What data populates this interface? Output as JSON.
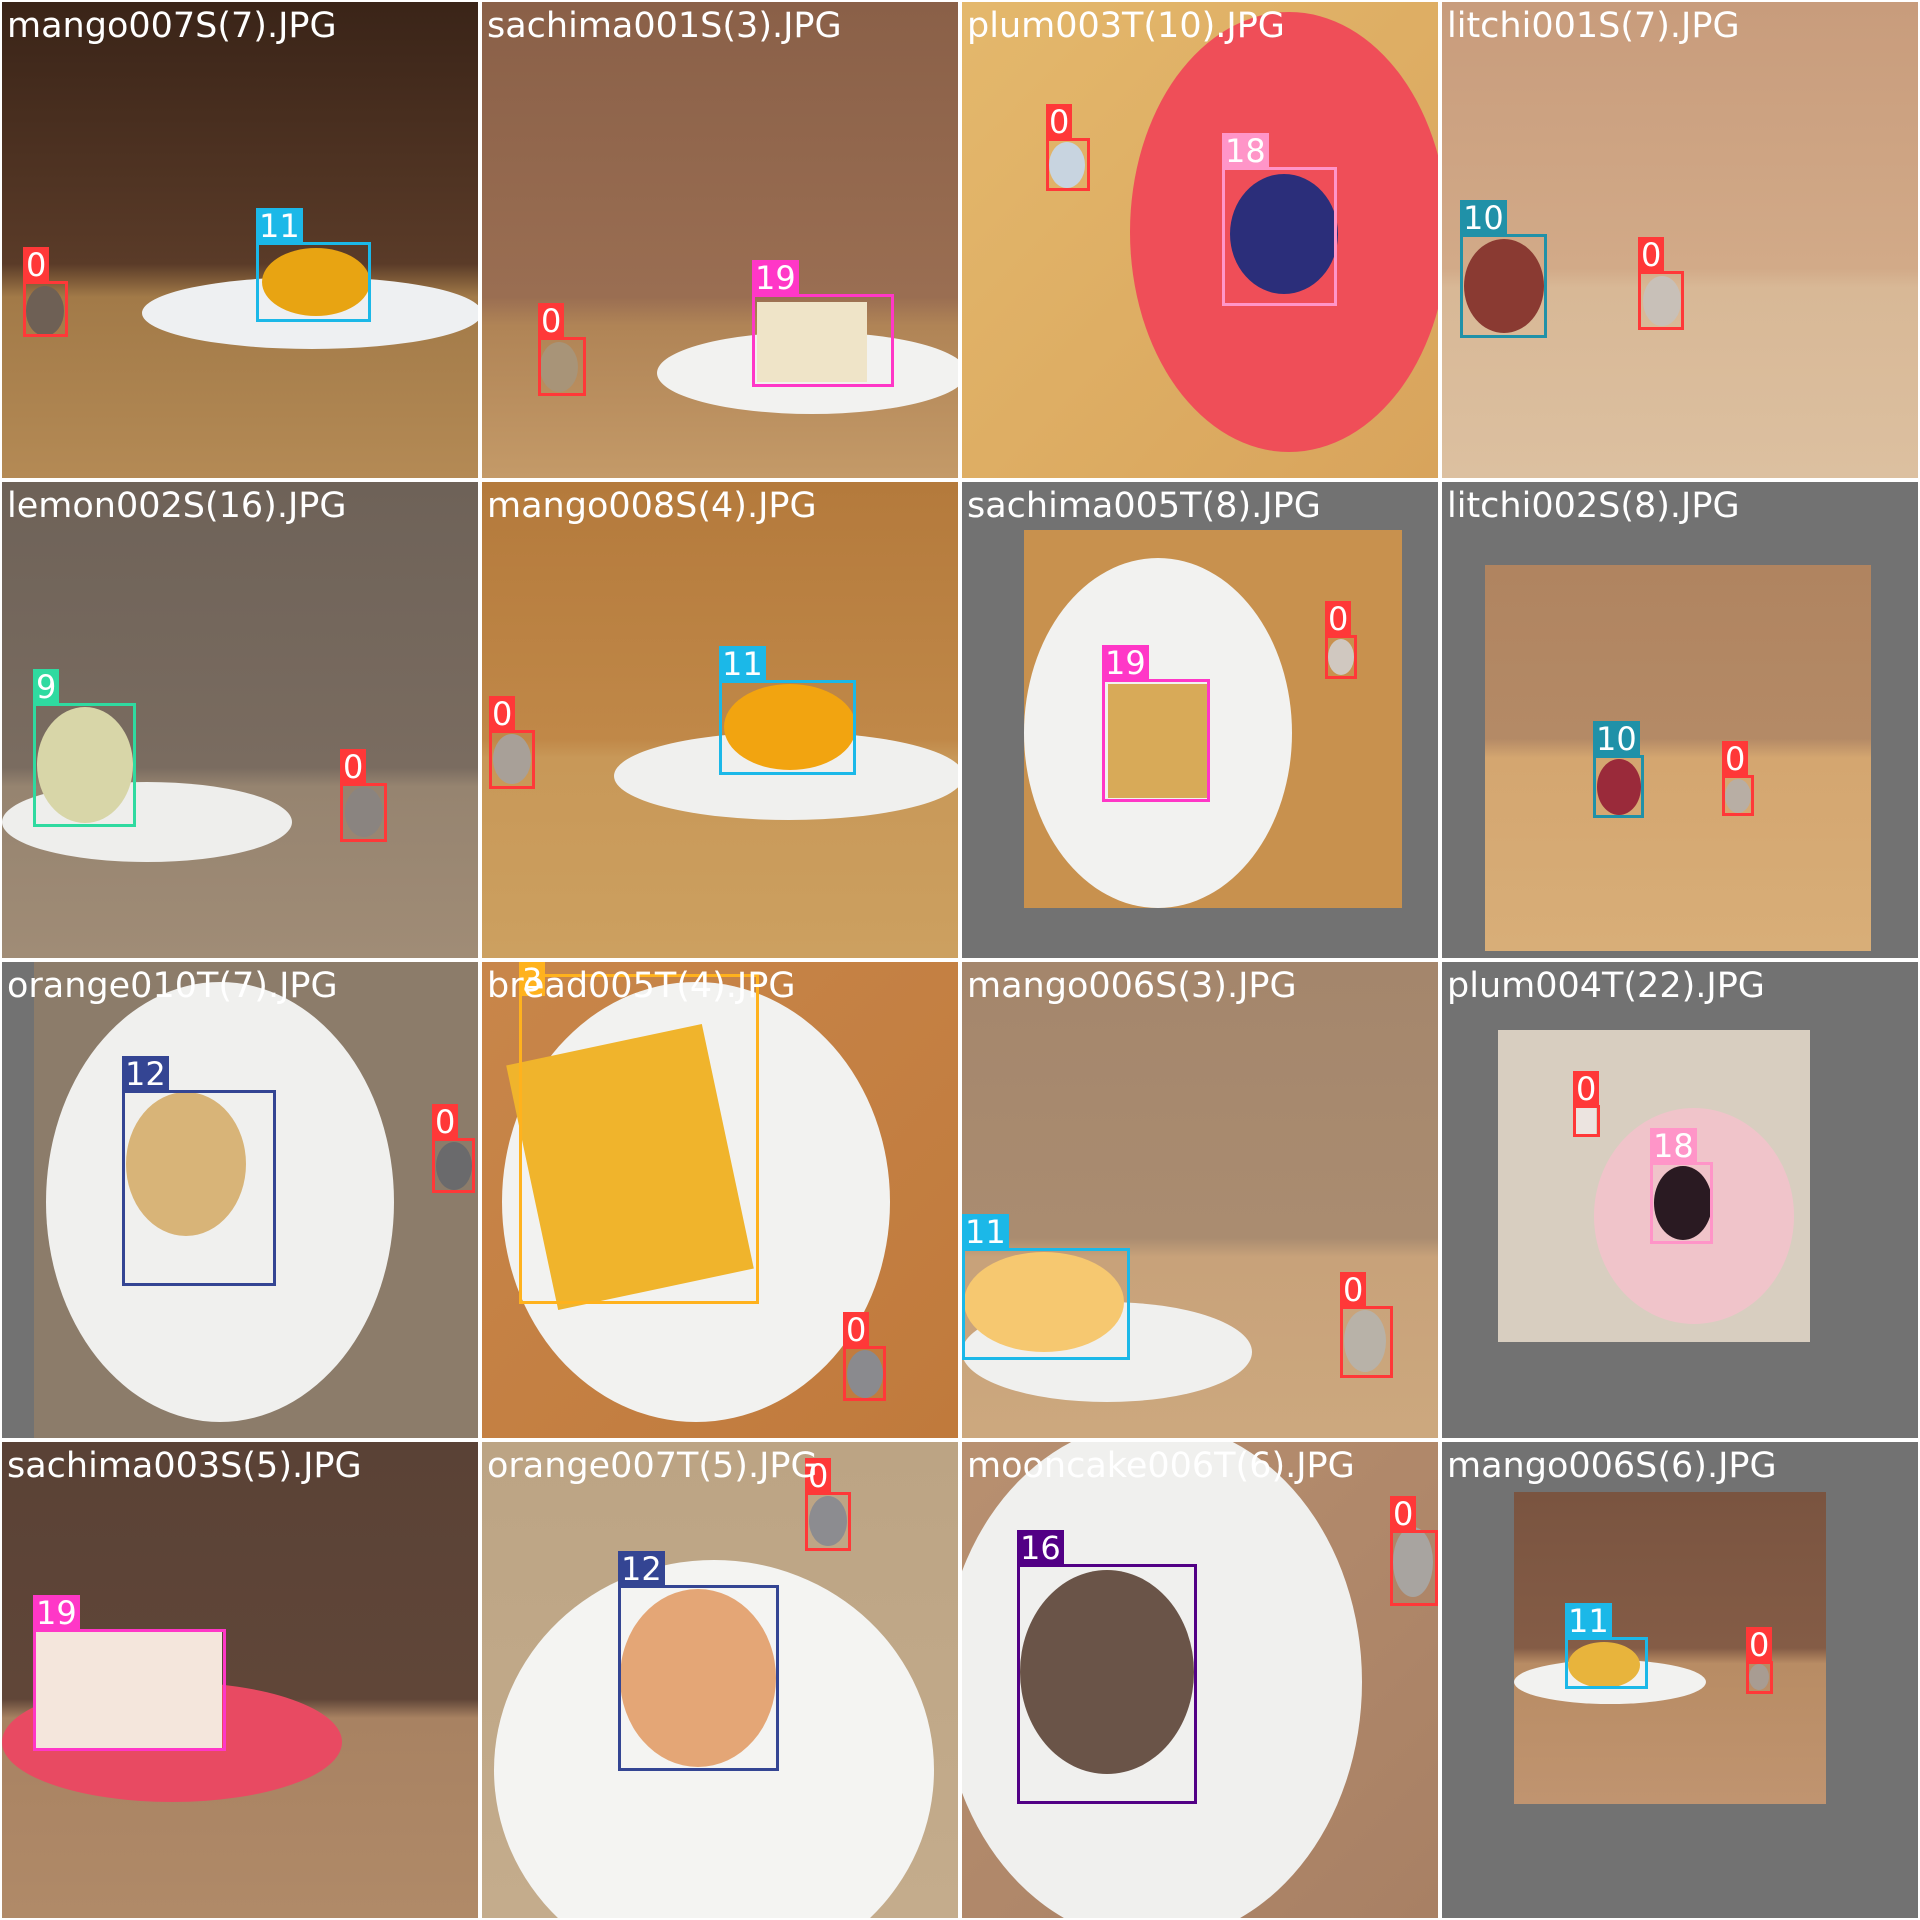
{
  "tiles": [
    {
      "file": "mango007S(7).JPG",
      "detections": [
        {
          "label": "0"
        },
        {
          "label": "11"
        }
      ]
    },
    {
      "file": "sachima001S(3).JPG",
      "detections": [
        {
          "label": "0"
        },
        {
          "label": "19"
        }
      ]
    },
    {
      "file": "plum003T(10).JPG",
      "detections": [
        {
          "label": "0"
        },
        {
          "label": "18"
        }
      ]
    },
    {
      "file": "litchi001S(7).JPG",
      "detections": [
        {
          "label": "10"
        },
        {
          "label": "0"
        }
      ]
    },
    {
      "file": "lemon002S(16).JPG",
      "detections": [
        {
          "label": "9"
        },
        {
          "label": "0"
        }
      ]
    },
    {
      "file": "mango008S(4).JPG",
      "detections": [
        {
          "label": "0"
        },
        {
          "label": "11"
        }
      ]
    },
    {
      "file": "sachima005T(8).JPG",
      "detections": [
        {
          "label": "19"
        },
        {
          "label": "0"
        }
      ]
    },
    {
      "file": "litchi002S(8).JPG",
      "detections": [
        {
          "label": "10"
        },
        {
          "label": "0"
        }
      ]
    },
    {
      "file": "orange010T(7).JPG",
      "detections": [
        {
          "label": "12"
        },
        {
          "label": "0"
        }
      ]
    },
    {
      "file": "bread005T(4).JPG",
      "detections": [
        {
          "label": "3"
        },
        {
          "label": "0"
        }
      ]
    },
    {
      "file": "mango006S(3).JPG",
      "detections": [
        {
          "label": "11"
        },
        {
          "label": "0"
        }
      ]
    },
    {
      "file": "plum004T(22).JPG",
      "detections": [
        {
          "label": "0"
        },
        {
          "label": "18"
        }
      ]
    },
    {
      "file": "sachima003S(5).JPG",
      "detections": [
        {
          "label": "19"
        }
      ]
    },
    {
      "file": "orange007T(5).JPG",
      "detections": [
        {
          "label": "0"
        },
        {
          "label": "12"
        }
      ]
    },
    {
      "file": "mooncake006T(6).JPG",
      "detections": [
        {
          "label": "16"
        },
        {
          "label": "0"
        }
      ]
    },
    {
      "file": "mango006S(6).JPG",
      "detections": [
        {
          "label": "11"
        },
        {
          "label": "0"
        }
      ]
    }
  ],
  "class_colors": {
    "0": "#ff3838",
    "3": "#ffb21d",
    "9": "#2fdaa0",
    "10": "#2091a8",
    "11": "#1bb8e8",
    "12": "#344593",
    "16": "#520085",
    "18": "#ff95c8",
    "19": "#ff37c7"
  }
}
